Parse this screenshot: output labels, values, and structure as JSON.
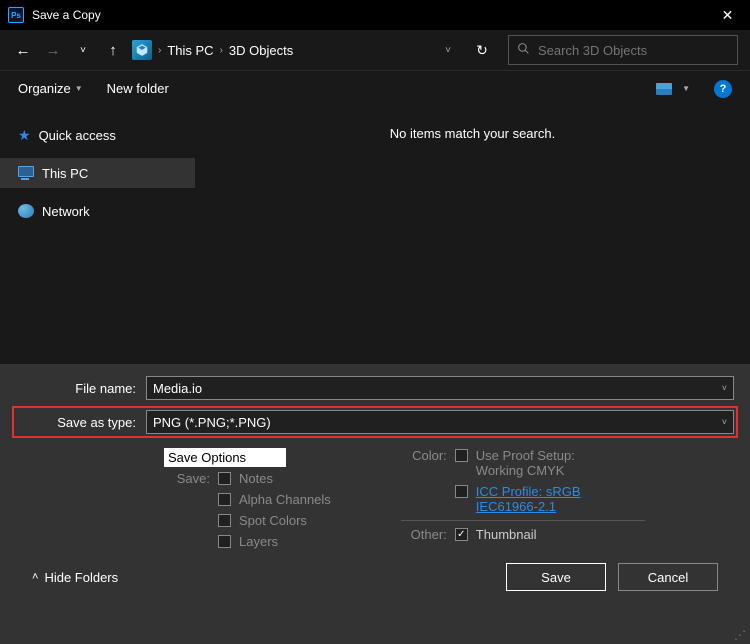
{
  "window": {
    "title": "Save a Copy"
  },
  "nav": {
    "location_root": "This PC",
    "location_folder": "3D Objects",
    "search_placeholder": "Search 3D Objects"
  },
  "toolbar": {
    "organize": "Organize",
    "new_folder": "New folder"
  },
  "sidebar": {
    "items": [
      {
        "label": "Quick access"
      },
      {
        "label": "This PC"
      },
      {
        "label": "Network"
      }
    ]
  },
  "content": {
    "empty_message": "No items match your search."
  },
  "form": {
    "filename_label": "File name:",
    "filename_value": "Media.io",
    "savetype_label": "Save as type:",
    "savetype_value": "PNG (*.PNG;*.PNG)"
  },
  "options": {
    "header": "Save Options",
    "save_label": "Save:",
    "save_items": [
      "Notes",
      "Alpha Channels",
      "Spot Colors",
      "Layers"
    ],
    "color_label": "Color:",
    "color_proof": "Use Proof Setup:",
    "color_proof_sub": "Working CMYK",
    "icc_profile": "ICC Profile:  sRGB IEC61966-2.1",
    "other_label": "Other:",
    "thumbnail": "Thumbnail"
  },
  "footer": {
    "hide_folders": "Hide Folders",
    "save": "Save",
    "cancel": "Cancel"
  }
}
